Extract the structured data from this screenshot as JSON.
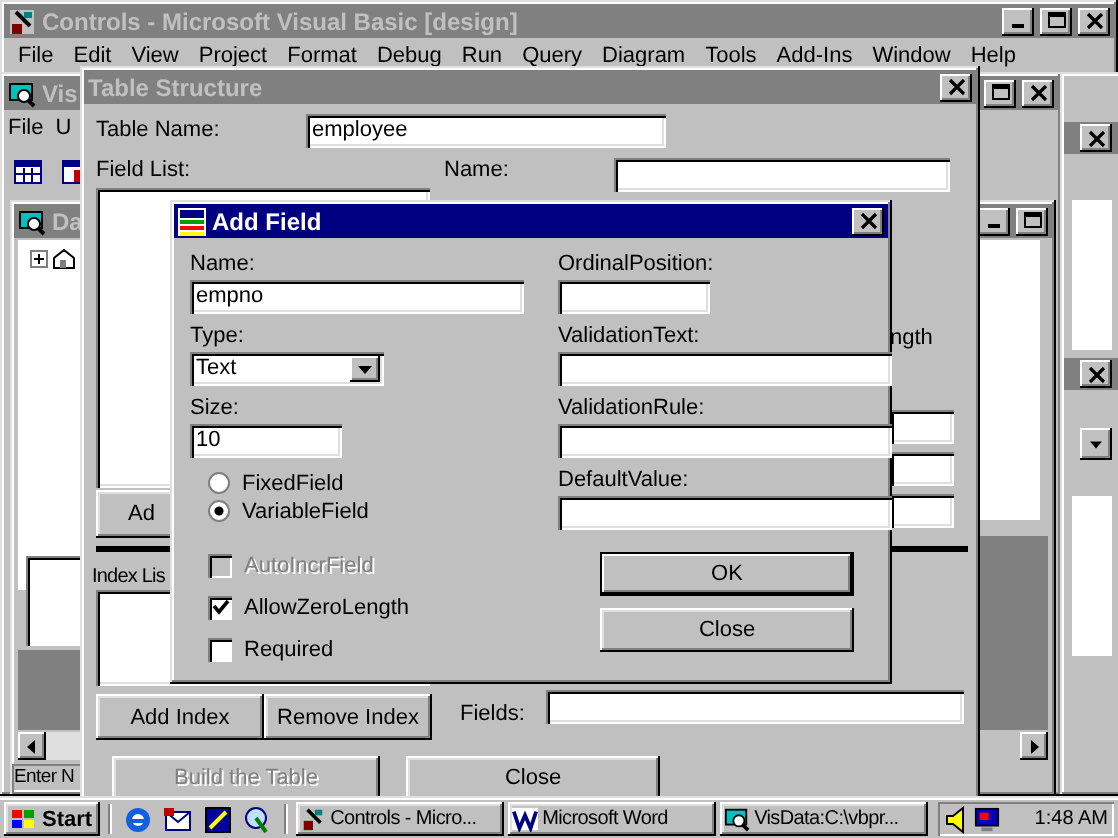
{
  "vb_window": {
    "title": "Controls - Microsoft Visual Basic [design]",
    "active": false,
    "menu": [
      "File",
      "Edit",
      "View",
      "Project",
      "Format",
      "Debug",
      "Run",
      "Query",
      "Diagram",
      "Tools",
      "Add-Ins",
      "Window",
      "Help"
    ]
  },
  "visdata_window": {
    "title": "Vis",
    "active": false,
    "menu": [
      "File",
      "U"
    ]
  },
  "database_window": {
    "title": "Da",
    "active": false,
    "status": "Enter N"
  },
  "table_structure": {
    "title": "Table Structure",
    "active": false,
    "table_name_label": "Table Name:",
    "table_name": "employee",
    "field_list_label": "Field List:",
    "name_label": "Name:",
    "side_label": "ngth",
    "add_button": {
      "label": "Ad",
      "disabled": false
    },
    "index_list_label": "Index Lis",
    "index_buttons": [
      {
        "label": "Add Index",
        "disabled": false
      },
      {
        "label": "Remove Index",
        "disabled": false
      }
    ],
    "fields_label": "Fields:",
    "bottom_buttons": [
      {
        "label": "Build the Table",
        "disabled": true
      },
      {
        "label": "Close",
        "disabled": false
      }
    ]
  },
  "add_field": {
    "title": "Add Field",
    "active": true,
    "name_label": "Name:",
    "name": "empno",
    "type_label": "Type:",
    "type": "Text",
    "size_label": "Size:",
    "size": "10",
    "radios": [
      {
        "label": "FixedField",
        "selected": false
      },
      {
        "label": "VariableField",
        "selected": true
      }
    ],
    "checkboxes": [
      {
        "label": "AutoIncrField",
        "checked": false,
        "disabled": true
      },
      {
        "label": "AllowZeroLength",
        "checked": true,
        "disabled": false
      },
      {
        "label": "Required",
        "checked": false,
        "disabled": false
      }
    ],
    "right_fields": [
      {
        "label": "OrdinalPosition:"
      },
      {
        "label": "ValidationText:"
      },
      {
        "label": "ValidationRule:"
      },
      {
        "label": "DefaultValue:"
      }
    ],
    "buttons": [
      {
        "label": "OK",
        "default": true
      },
      {
        "label": "Close",
        "default": false
      }
    ]
  },
  "taskbar": {
    "start": "Start",
    "tasks": [
      {
        "label": "Controls - Micro...",
        "selected": false
      },
      {
        "label": "Microsoft Word",
        "selected": false
      },
      {
        "label": "VisData:C:\\vbpr...",
        "selected": false
      }
    ],
    "clock": "1:48 AM"
  }
}
